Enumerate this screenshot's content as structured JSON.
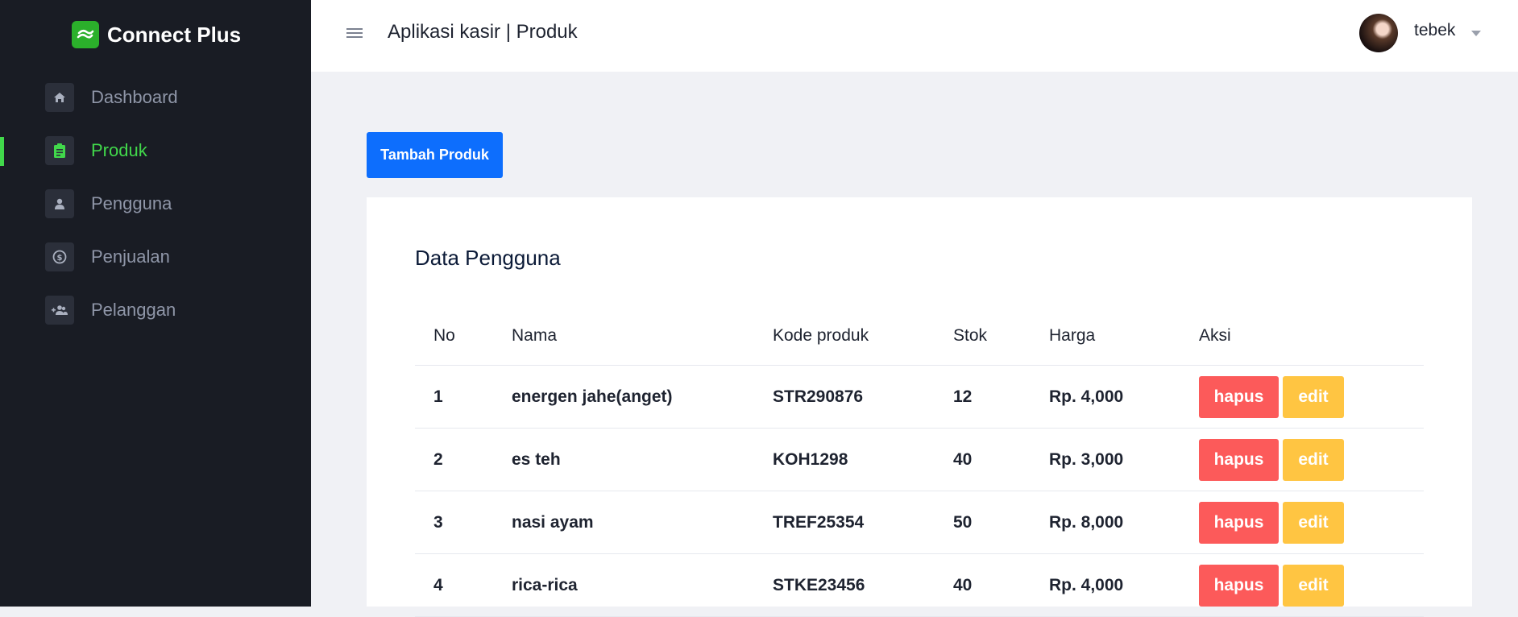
{
  "brand": {
    "name": "Connect Plus",
    "logo_icon": "leaf-logo-icon",
    "logo_color": "#2bb02b"
  },
  "sidebar": {
    "items": [
      {
        "label": "Dashboard",
        "icon": "home-icon",
        "active": false
      },
      {
        "label": "Produk",
        "icon": "clipboard-icon",
        "active": true
      },
      {
        "label": "Pengguna",
        "icon": "user-icon",
        "active": false
      },
      {
        "label": "Penjualan",
        "icon": "dollar-coin-icon",
        "active": false
      },
      {
        "label": "Pelanggan",
        "icon": "add-group-icon",
        "active": false
      }
    ],
    "active_color": "#41d84b"
  },
  "header": {
    "title": "Aplikasi kasir | Produk",
    "username": "tebek"
  },
  "main": {
    "add_button_label": "Tambah Produk",
    "card_title": "Data Pengguna",
    "columns": [
      "No",
      "Nama",
      "Kode produk",
      "Stok",
      "Harga",
      "Aksi"
    ],
    "rows": [
      {
        "no": "1",
        "nama": "energen jahe(anget)",
        "kode": "STR290876",
        "stok": "12",
        "harga": "Rp. 4,000"
      },
      {
        "no": "2",
        "nama": "es teh",
        "kode": "KOH1298",
        "stok": "40",
        "harga": "Rp. 3,000"
      },
      {
        "no": "3",
        "nama": "nasi ayam",
        "kode": "TREF25354",
        "stok": "50",
        "harga": "Rp. 8,000"
      },
      {
        "no": "4",
        "nama": "rica-rica",
        "kode": "STKE23456",
        "stok": "40",
        "harga": "Rp. 4,000"
      }
    ],
    "delete_label": "hapus",
    "edit_label": "edit",
    "colors": {
      "primary": "#0d6efd",
      "delete": "#fc5a5a",
      "edit": "#ffc542"
    }
  }
}
